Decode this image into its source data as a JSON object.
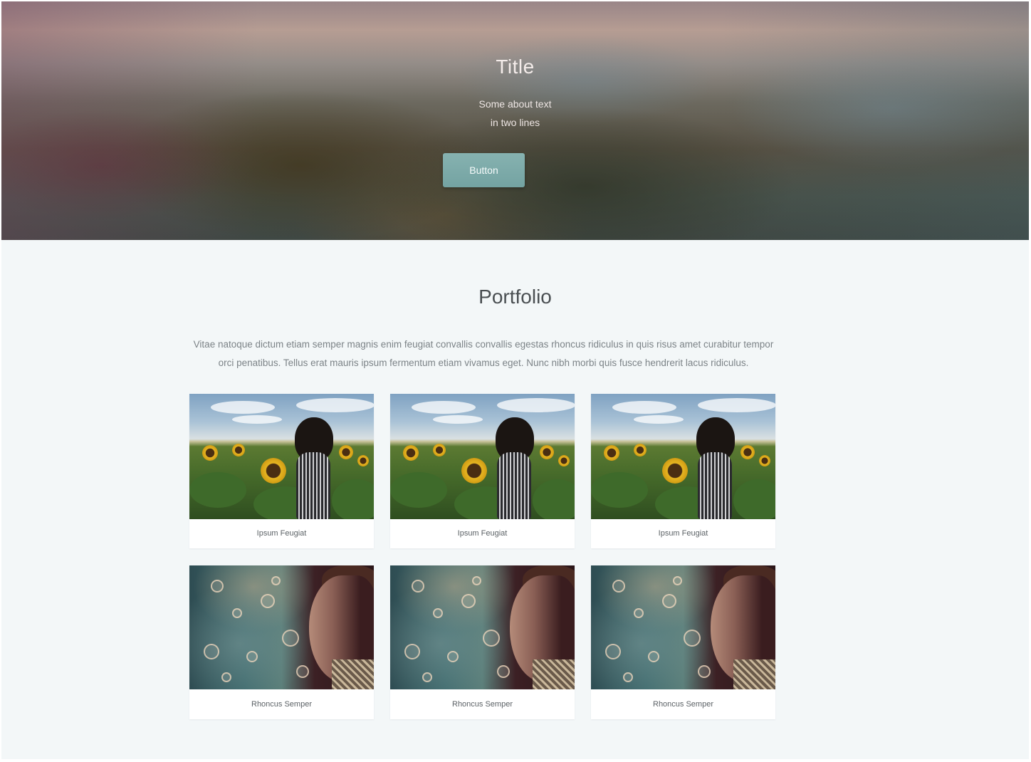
{
  "hero": {
    "title": "Title",
    "subtitle_line1": "Some about text",
    "subtitle_line2": "in two lines",
    "button_label": "Button",
    "accent_color": "#7aa8a7"
  },
  "portfolio": {
    "title": "Portfolio",
    "description": "Vitae natoque dictum etiam semper magnis enim feugiat convallis convallis egestas rhoncus ridiculus in quis risus amet curabitur tempor orci penatibus. Tellus erat mauris ipsum fermentum etiam vivamus eget. Nunc nibh morbi quis fusce hendrerit lacus ridiculus.",
    "items": [
      {
        "caption": "Ipsum Feugiat"
      },
      {
        "caption": "Ipsum Feugiat"
      },
      {
        "caption": "Ipsum Feugiat"
      },
      {
        "caption": "Rhoncus Semper"
      },
      {
        "caption": "Rhoncus Semper"
      },
      {
        "caption": "Rhoncus Semper"
      }
    ]
  }
}
